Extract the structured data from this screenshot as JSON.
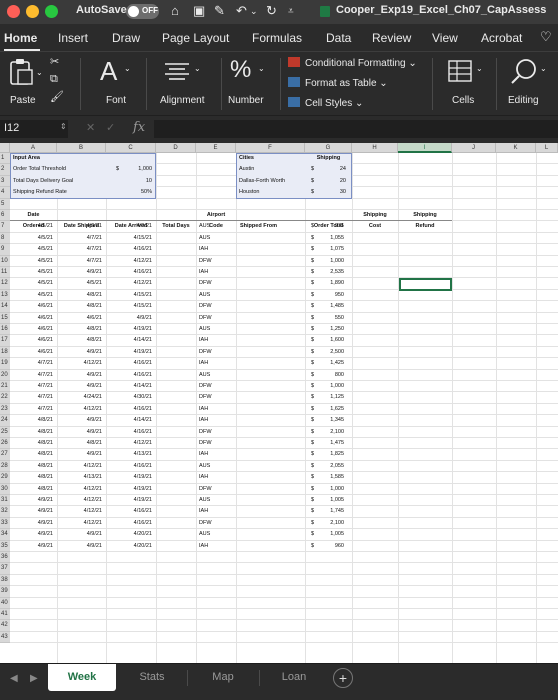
{
  "titlebar": {
    "autosave_label": "AutoSave",
    "autosave_state": "OFF",
    "document_title": "Cooper_Exp19_Excel_Ch07_CapAssess"
  },
  "menu": {
    "tabs": [
      "Home",
      "Insert",
      "Draw",
      "Page Layout",
      "Formulas",
      "Data",
      "Review",
      "View",
      "Acrobat"
    ],
    "active": "Home"
  },
  "ribbon": {
    "paste": "Paste",
    "font": "Font",
    "alignment": "Alignment",
    "number": "Number",
    "conditional_formatting": "Conditional Formatting",
    "format_as_table": "Format as Table",
    "cell_styles": "Cell Styles",
    "cells": "Cells",
    "editing": "Editing"
  },
  "formula_bar": {
    "name_box": "I12",
    "fx_label": "fx",
    "value": ""
  },
  "columns": [
    "A",
    "B",
    "C",
    "D",
    "E",
    "F",
    "G",
    "H",
    "I",
    "J",
    "K",
    "L"
  ],
  "row_numbers": [
    "1",
    "2",
    "3",
    "4",
    "5",
    "6",
    "7",
    "8",
    "9",
    "10",
    "11",
    "12",
    "13",
    "14",
    "15",
    "16",
    "17",
    "18",
    "19",
    "20",
    "21",
    "22",
    "23",
    "24",
    "25",
    "26",
    "27",
    "28",
    "29",
    "30",
    "31",
    "32",
    "33",
    "34",
    "35",
    "36",
    "37",
    "38",
    "39",
    "40",
    "41",
    "42",
    "43"
  ],
  "input_area": {
    "title": "Input Area",
    "rows": [
      {
        "label": "Order Total Threshold",
        "currency": "$",
        "value": "1,000"
      },
      {
        "label": "Total Days Delivery Goal",
        "currency": "",
        "value": "10"
      },
      {
        "label": "Shipping Refund Rate",
        "currency": "",
        "value": "50%"
      }
    ]
  },
  "shipping_lookup": {
    "header_cities": "Cities",
    "header_shipping": "Shipping",
    "rows": [
      {
        "city": "Austin",
        "currency": "$",
        "value": "24"
      },
      {
        "city": "Dallas-Forth Worth",
        "currency": "$",
        "value": "20"
      },
      {
        "city": "Houston",
        "currency": "$",
        "value": "30"
      }
    ]
  },
  "table_headers": {
    "date_ordered_1": "Date",
    "date_ordered_2": "Ordered",
    "date_shipped": "Date Shipped",
    "date_arrived": "Date Arrived",
    "total_days": "Total Days",
    "airport_1": "Airport",
    "airport_2": "Code",
    "shipped_from": "Shipped From",
    "order_total": "Order Total",
    "shipping_cost_1": "Shipping",
    "shipping_cost_2": "Cost",
    "shipping_refund_1": "Shipping",
    "shipping_refund_2": "Refund"
  },
  "orders": [
    [
      "4/5/21",
      "4/6/21",
      "4/9/21",
      "AUS",
      "975"
    ],
    [
      "4/5/21",
      "4/7/21",
      "4/15/21",
      "AUS",
      "1,055"
    ],
    [
      "4/5/21",
      "4/7/21",
      "4/16/21",
      "IAH",
      "1,075"
    ],
    [
      "4/5/21",
      "4/7/21",
      "4/12/21",
      "DFW",
      "1,000"
    ],
    [
      "4/5/21",
      "4/9/21",
      "4/16/21",
      "IAH",
      "2,535"
    ],
    [
      "4/5/21",
      "4/5/21",
      "4/12/21",
      "DFW",
      "1,890"
    ],
    [
      "4/5/21",
      "4/8/21",
      "4/15/21",
      "AUS",
      "950"
    ],
    [
      "4/6/21",
      "4/8/21",
      "4/15/21",
      "DFW",
      "1,485"
    ],
    [
      "4/6/21",
      "4/6/21",
      "4/9/21",
      "DFW",
      "550"
    ],
    [
      "4/6/21",
      "4/8/21",
      "4/19/21",
      "AUS",
      "1,250"
    ],
    [
      "4/6/21",
      "4/8/21",
      "4/14/21",
      "IAH",
      "1,600"
    ],
    [
      "4/6/21",
      "4/9/21",
      "4/19/21",
      "DFW",
      "2,500"
    ],
    [
      "4/7/21",
      "4/12/21",
      "4/16/21",
      "IAH",
      "1,425"
    ],
    [
      "4/7/21",
      "4/9/21",
      "4/16/21",
      "AUS",
      "800"
    ],
    [
      "4/7/21",
      "4/9/21",
      "4/14/21",
      "DFW",
      "1,000"
    ],
    [
      "4/7/21",
      "4/24/21",
      "4/30/21",
      "DFW",
      "1,125"
    ],
    [
      "4/7/21",
      "4/12/21",
      "4/16/21",
      "IAH",
      "1,625"
    ],
    [
      "4/8/21",
      "4/9/21",
      "4/14/21",
      "IAH",
      "1,345"
    ],
    [
      "4/8/21",
      "4/9/21",
      "4/16/21",
      "DFW",
      "2,100"
    ],
    [
      "4/8/21",
      "4/8/21",
      "4/12/21",
      "DFW",
      "1,475"
    ],
    [
      "4/8/21",
      "4/9/21",
      "4/13/21",
      "IAH",
      "1,825"
    ],
    [
      "4/8/21",
      "4/12/21",
      "4/16/21",
      "AUS",
      "2,055"
    ],
    [
      "4/8/21",
      "4/13/21",
      "4/19/21",
      "IAH",
      "1,585"
    ],
    [
      "4/8/21",
      "4/12/21",
      "4/19/21",
      "DFW",
      "1,000"
    ],
    [
      "4/9/21",
      "4/12/21",
      "4/19/21",
      "AUS",
      "1,005"
    ],
    [
      "4/9/21",
      "4/12/21",
      "4/16/21",
      "IAH",
      "1,745"
    ],
    [
      "4/9/21",
      "4/12/21",
      "4/16/21",
      "DFW",
      "2,100"
    ],
    [
      "4/9/21",
      "4/9/21",
      "4/20/21",
      "AUS",
      "1,005"
    ],
    [
      "4/9/21",
      "4/9/21",
      "4/20/21",
      "IAH",
      "960"
    ]
  ],
  "currency_symbol": "$",
  "sheets": [
    "Week",
    "Stats",
    "Map",
    "Loan"
  ],
  "active_sheet": "Week",
  "colors": {
    "excel_green": "#217346",
    "dark_chrome": "#2b2b2b"
  }
}
